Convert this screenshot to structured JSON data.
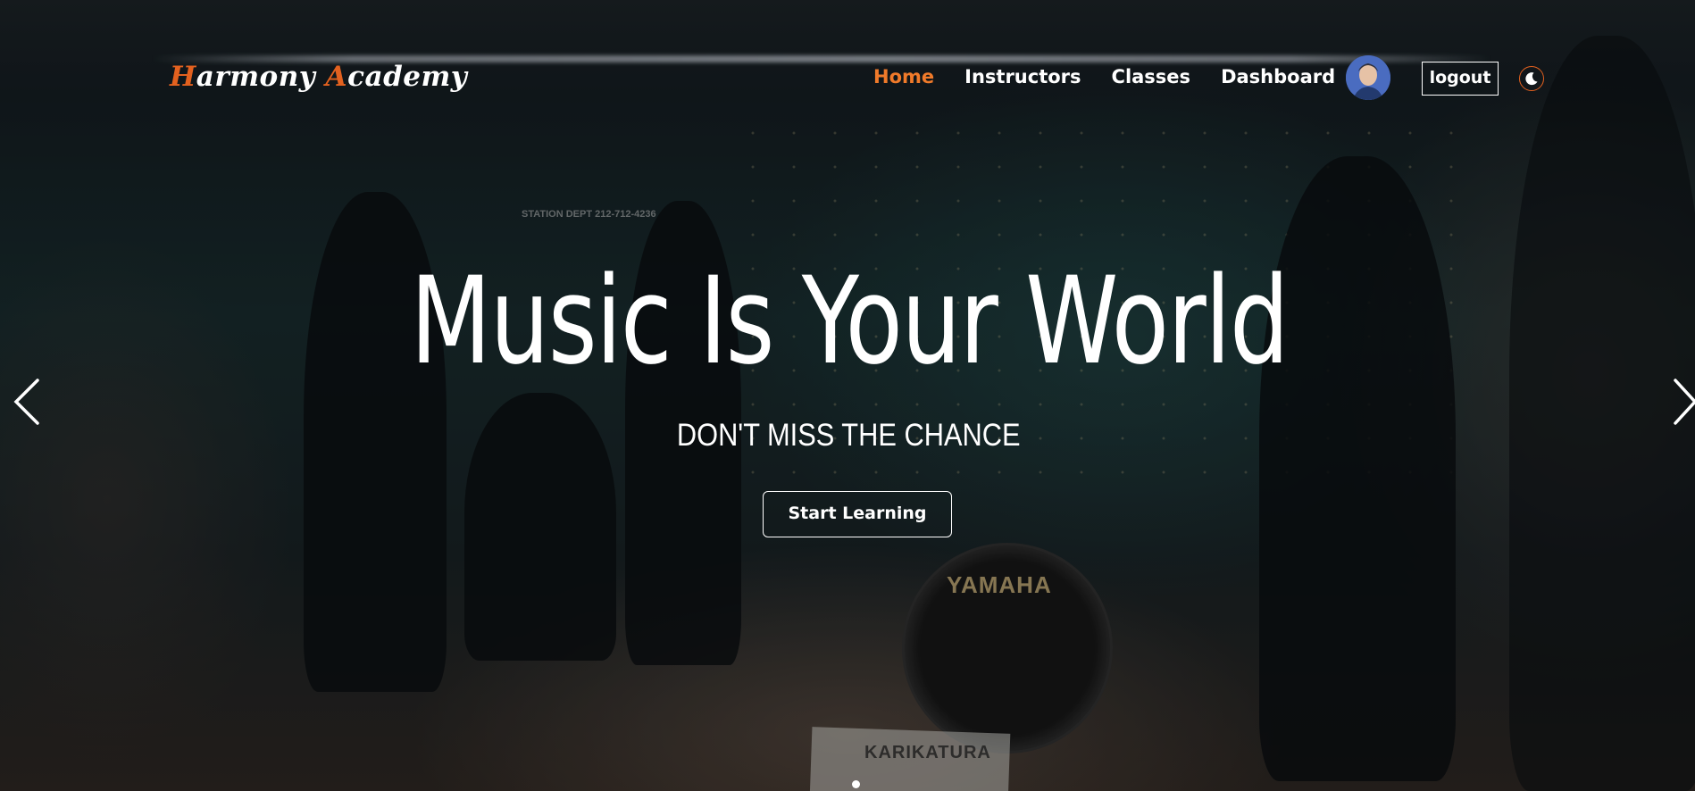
{
  "brand": {
    "first_initial": "H",
    "first_rest": "armony",
    "second_initial": "A",
    "second_rest": "cademy"
  },
  "nav": {
    "items": [
      {
        "label": "Home",
        "active": true
      },
      {
        "label": "Instructors",
        "active": false
      },
      {
        "label": "Classes",
        "active": false
      },
      {
        "label": "Dashboard",
        "active": false
      }
    ],
    "logout_label": "logout",
    "theme_icon": "moon-icon"
  },
  "hero": {
    "title": "Music Is Your World",
    "subtitle": "DON'T MISS THE CHANCE",
    "cta_label": "Start Learning",
    "background_text": {
      "station": "STATION DEPT 212-712-4236",
      "drum_brand": "YAMAHA",
      "sign": "KARIKATURA"
    }
  },
  "carousel": {
    "prev_icon": "chevron-left-icon",
    "next_icon": "chevron-right-icon"
  },
  "colors": {
    "accent": "#e3611f",
    "active_link": "#f07a2a",
    "text": "#ffffff"
  }
}
